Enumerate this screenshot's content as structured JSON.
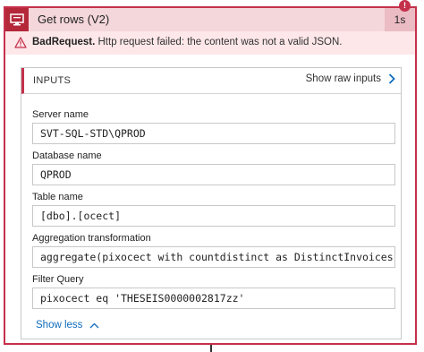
{
  "action": {
    "title": "Get rows (V2)",
    "duration": "1s",
    "badge": "!",
    "icon": "sql-server-icon"
  },
  "error": {
    "icon": "warning-triangle-icon",
    "type": "BadRequest.",
    "message": "Http request failed: the content was not a valid JSON."
  },
  "inputs": {
    "title": "INPUTS",
    "show_raw_label": "Show raw inputs",
    "fields": [
      {
        "label": "Server name",
        "value": "SVT-SQL-STD\\QPROD"
      },
      {
        "label": "Database name",
        "value": "QPROD"
      },
      {
        "label": "Table name",
        "value": "[dbo].[ocect]"
      },
      {
        "label": "Aggregation transformation",
        "value": "aggregate(pixocect with countdistinct as DistinctInvoices)"
      },
      {
        "label": "Filter Query",
        "value": "pixocect eq 'THESEIS0000002817zz'"
      }
    ],
    "show_less_label": "Show less"
  },
  "colors": {
    "accent_red": "#c4314b",
    "header_bg": "#f4d7db",
    "error_bg": "#fde7e9",
    "link_blue": "#0f6cbd"
  }
}
